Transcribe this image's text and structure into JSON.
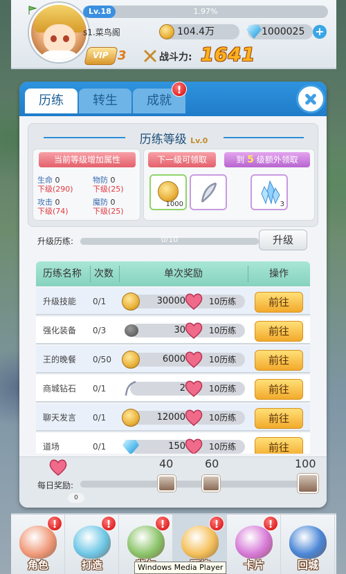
{
  "player": {
    "level": "Lv.18",
    "exp_percent": "1.97%",
    "exp_fraction": 0.0197,
    "name": "s1.菜鸟阁",
    "gold": "104.4万",
    "diamonds": "1000025",
    "vip_label": "VIP",
    "vip_level": "3",
    "power_label": "战斗力:",
    "power_value": "1641"
  },
  "tabs": [
    {
      "label": "历练",
      "active": true
    },
    {
      "label": "转生",
      "active": false
    },
    {
      "label": "成就",
      "active": false,
      "badge": "!"
    }
  ],
  "level_section": {
    "title": "历练等级",
    "level": "Lv.0",
    "stats_header": "当前等级增加属性",
    "stats": [
      {
        "key": "生命",
        "value": "0",
        "next_label": "下级",
        "next_value": "(290)"
      },
      {
        "key": "物防",
        "value": "0",
        "next_label": "下级",
        "next_value": "(25)"
      },
      {
        "key": "攻击",
        "value": "0",
        "next_label": "下级",
        "next_value": "(74)"
      },
      {
        "key": "魔防",
        "value": "0",
        "next_label": "下级",
        "next_value": "(25)"
      }
    ],
    "next_reward_header": "下一级可领取",
    "next_rewards": [
      {
        "icon": "gold-coin-icon",
        "count": "1000"
      },
      {
        "icon": "feather-icon",
        "count": ""
      }
    ],
    "extra_header_pre": "到",
    "extra_header_num": "5",
    "extra_header_post": "级额外领取",
    "extra_rewards": [
      {
        "icon": "crystal-icon",
        "count": "3"
      }
    ]
  },
  "upgrade": {
    "label": "升级历练:",
    "progress_text": "0/10",
    "progress_fraction": 0,
    "button": "升级"
  },
  "table": {
    "headers": [
      "历练名称",
      "次数",
      "单次奖励",
      "操作"
    ],
    "rows": [
      {
        "name": "升级技能",
        "count": "0/1",
        "reward_icon": "gold-coin-icon",
        "reward": "30000",
        "exp": "10历练",
        "action": "前往"
      },
      {
        "name": "强化装备",
        "count": "0/3",
        "reward_icon": "stone-icon",
        "reward": "30",
        "exp": "10历练",
        "action": "前往"
      },
      {
        "name": "王的晚餐",
        "count": "0/50",
        "reward_icon": "gold-coin-icon",
        "reward": "6000",
        "exp": "10历练",
        "action": "前往"
      },
      {
        "name": "商城钻石",
        "count": "0/1",
        "reward_icon": "feather-icon",
        "reward": "2",
        "exp": "10历练",
        "action": "前往"
      },
      {
        "name": "聊天发言",
        "count": "0/1",
        "reward_icon": "gold-coin-icon",
        "reward": "12000",
        "exp": "10历练",
        "action": "前往"
      },
      {
        "name": "道场",
        "count": "0/1",
        "reward_icon": "diamond-icon",
        "reward": "150",
        "exp": "10历练",
        "action": "前往"
      }
    ]
  },
  "daily": {
    "label": "每日奖励:",
    "current": "0",
    "progress_fraction": 0,
    "milestones": [
      "40",
      "60",
      "100"
    ]
  },
  "bottom_nav": [
    {
      "label": "角色",
      "badge": "!",
      "color": "#f09a7a"
    },
    {
      "label": "打造",
      "badge": "!",
      "color": "#6ec7e6"
    },
    {
      "label": "背包",
      "badge": "!",
      "color": "#8bc46a"
    },
    {
      "label": "历练",
      "badge": "!",
      "color": "#f4c05a"
    },
    {
      "label": "卡片",
      "badge": "!",
      "color": "#d77ad8"
    },
    {
      "label": "回城",
      "badge": "",
      "color": "#4a86d6"
    }
  ],
  "tooltip": "Windows Media Player"
}
